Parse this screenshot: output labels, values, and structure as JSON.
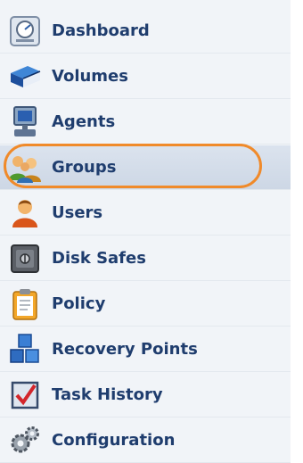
{
  "nav": {
    "items": [
      {
        "label": "Dashboard",
        "icon": "dashboard-icon"
      },
      {
        "label": "Volumes",
        "icon": "volumes-book-icon"
      },
      {
        "label": "Agents",
        "icon": "computer-icon"
      },
      {
        "label": "Groups",
        "icon": "group-users-icon",
        "selected": true
      },
      {
        "label": "Users",
        "icon": "user-icon"
      },
      {
        "label": "Disk Safes",
        "icon": "safe-icon"
      },
      {
        "label": "Policy",
        "icon": "clipboard-icon"
      },
      {
        "label": "Recovery Points",
        "icon": "cubes-icon"
      },
      {
        "label": "Task History",
        "icon": "checkbox-task-icon"
      },
      {
        "label": "Configuration",
        "icon": "gears-icon"
      }
    ],
    "highlight_color": "#f08a2a",
    "label_color": "#1f3d6e"
  }
}
